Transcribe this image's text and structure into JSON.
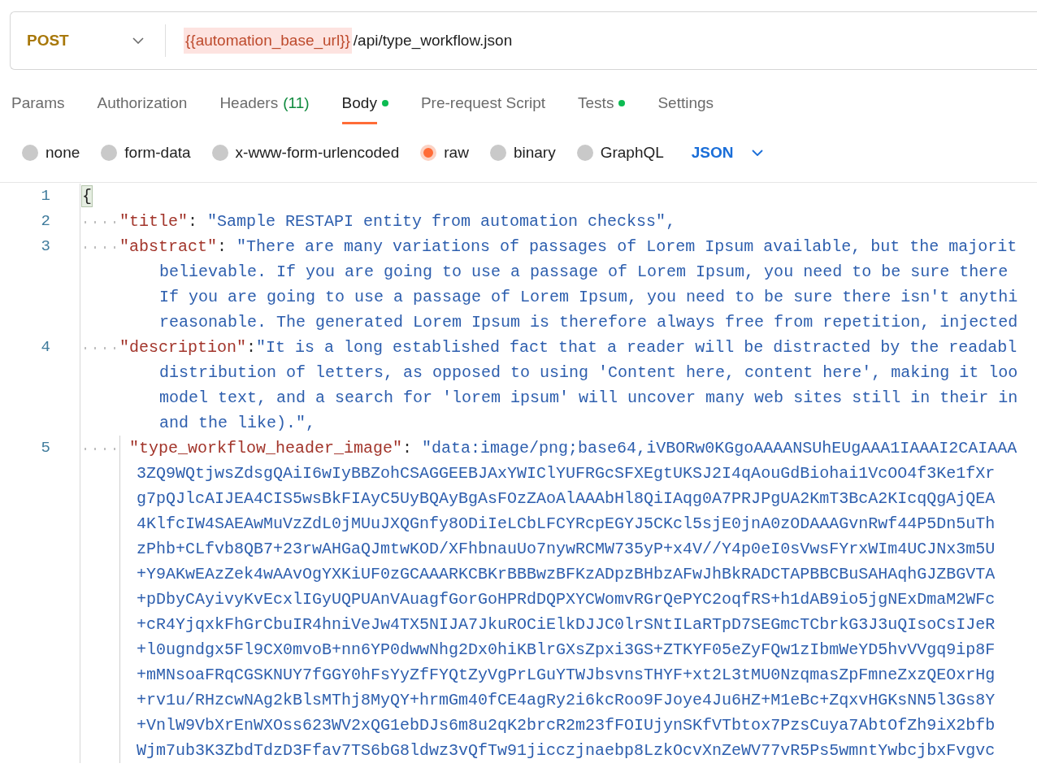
{
  "request": {
    "method": "POST",
    "url_variable": "{{automation_base_url}}",
    "url_path": "/api/type_workflow.json"
  },
  "tabs": [
    {
      "label": "Params",
      "selected": false
    },
    {
      "label": "Authorization",
      "selected": false
    },
    {
      "label": "Headers",
      "count": "(11)",
      "selected": false
    },
    {
      "label": "Body",
      "dot": true,
      "selected": true
    },
    {
      "label": "Pre-request Script",
      "selected": false
    },
    {
      "label": "Tests",
      "dot": true,
      "selected": false
    },
    {
      "label": "Settings",
      "selected": false
    }
  ],
  "body_types": [
    {
      "label": "none",
      "selected": false
    },
    {
      "label": "form-data",
      "selected": false
    },
    {
      "label": "x-www-form-urlencoded",
      "selected": false
    },
    {
      "label": "raw",
      "selected": true
    },
    {
      "label": "binary",
      "selected": false
    },
    {
      "label": "GraphQL",
      "selected": false
    }
  ],
  "format": "JSON",
  "editor": {
    "lines": [
      {
        "number": "1",
        "kind": "brace",
        "text": "{",
        "matched": true
      },
      {
        "number": "2",
        "kind": "pair",
        "key": "\"title\"",
        "colon": ":",
        "value": " \"Sample RESTAPI entity from automation checkss\","
      },
      {
        "number": "3",
        "kind": "pair",
        "key": "\"abstract\"",
        "colon": ":",
        "value": " \"There are many variations of passages of Lorem Ipsum available, but the majorit",
        "wrapped": [
          "believable. If you are going to use a passage of Lorem Ipsum, you need to be sure there",
          "If you are going to use a passage of Lorem Ipsum, you need to be sure there isn't anythi",
          "reasonable. The generated Lorem Ipsum is therefore always free from repetition, injected"
        ]
      },
      {
        "number": "4",
        "kind": "pair",
        "key": "\"description\"",
        "colon": ":",
        "value": "\"It is a long established fact that a reader will be distracted by the readabl",
        "wrapped": [
          "distribution of letters, as opposed to using 'Content here, content here', making it loo",
          "model text, and a search for 'lorem ipsum' will uncover many web sites still in their in",
          "and the like).\","
        ]
      },
      {
        "number": "5",
        "kind": "pair",
        "indent_guide": true,
        "key": "\"type_workflow_header_image\"",
        "colon": ":",
        "value": " \"data:image/png;base64,iVBORw0KGgoAAAANSUhEUgAAA1IAAAI2CAIAAA",
        "wrapped": [
          "3ZQ9WQtjwsZdsgQAiI6wIyBBZohCSAGGEEBJAxYWIClYUFRGcSFXEgtUKSJ2I4qAouGdBiohai1VcOO4f3Ke1fXr",
          "g7pQJlcAIJEA4CIS5wsBkFIAyC5UyBQAyBgAsFOzZAoAlAAAbHl8QiIAqg0A7PRJPgUA2KmT3BcA2KIcqQgAjQEA",
          "4KlfcIW4SAEAwMuVzZdL0jMUuJXQGnfy8ODiIeLCbLFCYRcpEGYJ5CKcl5sjE0jnA0zODAAAGvnRwf44P5Dn5uTh",
          "zPhb+CLfvb8QB7+23rwAHGaQJmtwKOD/XFhbnauUo7nywRCMW735yP+x4V//Y4p0eI0sVwsFYrxWIm4UCJNx3m5U",
          "+Y9AKwEAzZek4wAAvOgYXKiUF0zGCAAARKCBKrBBBwzBFKzADpzBHbzAFwJhBkRADCTAPBBCBuSAHAqhGJZBGVTA",
          "+pDbyCAyivyKvEcxlIGyUQPUAnVAuagfGorGoHPRdDQPXYCWomvRGrQePYC2oqfRS+h1dAB9io5jgNExDmaM2WFc",
          "+cR4YjqxkFhGrCbuIR4hniVeJw4TX5NIJA7JkuROCiElkDJJC0lrSNtILaRTpD7SEGmcTCbrkG3J3uQIsoCsIJeR",
          "+l0ugndgx5Fl9CX0mvoB+nn6YP0dwwNhg2Dx0hiKBlrGXsZpxi3GS+ZTKYF05eZyFQw1zIbmWeYD5hvVVgq9ip8F",
          "+mMNsoaFRqCGSKNUY7fGGY0hFsYyZfFYQtZyVgPrLGuYTWJbsvnsTHYF+xt2L3tMU0NzqmasZpFmneZxzQEOxrHg",
          "+rv1u/RHzcwNAg2kBlsMThj8MyQY+hrmGm40fCE4agRy2i6kcRoo9FJoye4Ju6HZ+M1eBc+ZqxvHGKsNN5l3Gs8Y",
          "+VnlW9VbXrEnWXOss623WV2xQG1ebDJs6m8u2qK2brcR2m23fFOIUjynSKfVTbtox7PzsCuya7AbtOfZh9iX2bfb",
          "Wjm7ub3K3ZbdTdzD3Ffav7TS6bG8ldwz3vQfTw91jicczjnaebp8LzkOcvXnZeWV77vR5Ps5wmntYwbcjbxFvgvc"
        ]
      }
    ]
  }
}
